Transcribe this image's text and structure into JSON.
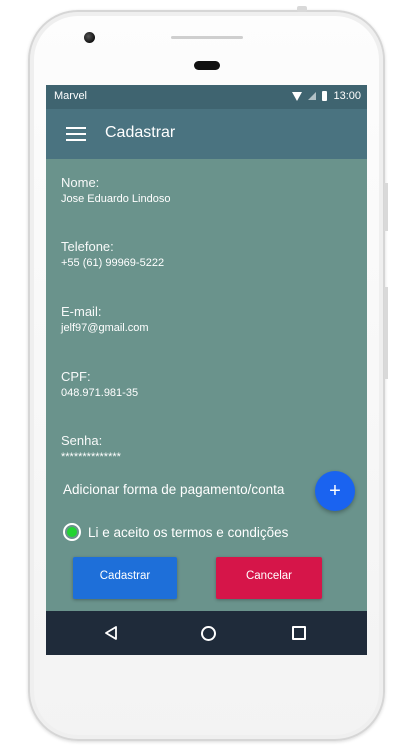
{
  "status_bar": {
    "carrier": "Marvel",
    "time": "13:00",
    "icons": [
      "wifi-icon",
      "signal-icon",
      "battery-icon"
    ]
  },
  "app_bar": {
    "menu_icon": "menu-icon",
    "title": "Cadastrar"
  },
  "form": {
    "fields": [
      {
        "label": "Nome:",
        "value": "Jose Eduardo Lindoso"
      },
      {
        "label": "Telefone:",
        "value": "+55 (61) 99969-5222"
      },
      {
        "label": "E-mail:",
        "value": "jelf97@gmail.com"
      },
      {
        "label": "CPF:",
        "value": "048.971.981-35"
      },
      {
        "label": "Senha:",
        "value": "**************"
      }
    ],
    "payment_label": "Adicionar forma de pagamento/conta",
    "add_button_icon": "+",
    "terms_label": "Li e aceito os termos e condições",
    "terms_checked": true
  },
  "buttons": {
    "submit": "Cadastrar",
    "cancel": "Cancelar"
  },
  "colors": {
    "screen_bg": "#6a938c",
    "app_bar": "#4a7380",
    "status_bar": "#3f6470",
    "fab": "#1a63f0",
    "submit": "#1e6fd9",
    "cancel": "#d61549",
    "radio_checked": "#22d432",
    "nav_bar": "#1f2b3a"
  },
  "nav_bar": {
    "icons": [
      "back-icon",
      "home-icon",
      "recent-apps-icon"
    ]
  }
}
